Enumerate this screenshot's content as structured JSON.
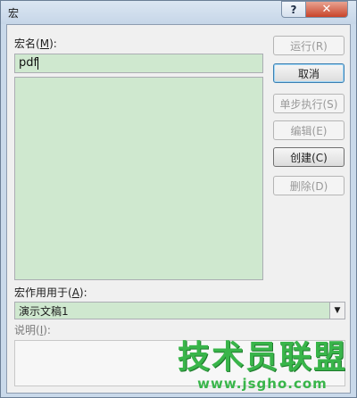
{
  "window": {
    "title": "宏",
    "help_label": "?",
    "close_label": "✕"
  },
  "form": {
    "macro_name_label": "宏名",
    "macro_name_mnemonic": "M",
    "macro_name_value": "pdf",
    "macro_in_label": "宏作用用于",
    "macro_in_mnemonic": "A",
    "macro_in_value": "演示文稿1",
    "description_label": "说明",
    "description_mnemonic": "I",
    "description_value": ""
  },
  "buttons": {
    "run": "运行(R)",
    "cancel": "取消",
    "step_into": "单步执行(S)",
    "edit": "编辑(E)",
    "create": "创建(C)",
    "delete": "删除(D)"
  },
  "watermark": {
    "brand": "技术员联盟",
    "url": "www.jsgho.com"
  },
  "icons": {
    "dropdown": "chevron-down-icon"
  }
}
